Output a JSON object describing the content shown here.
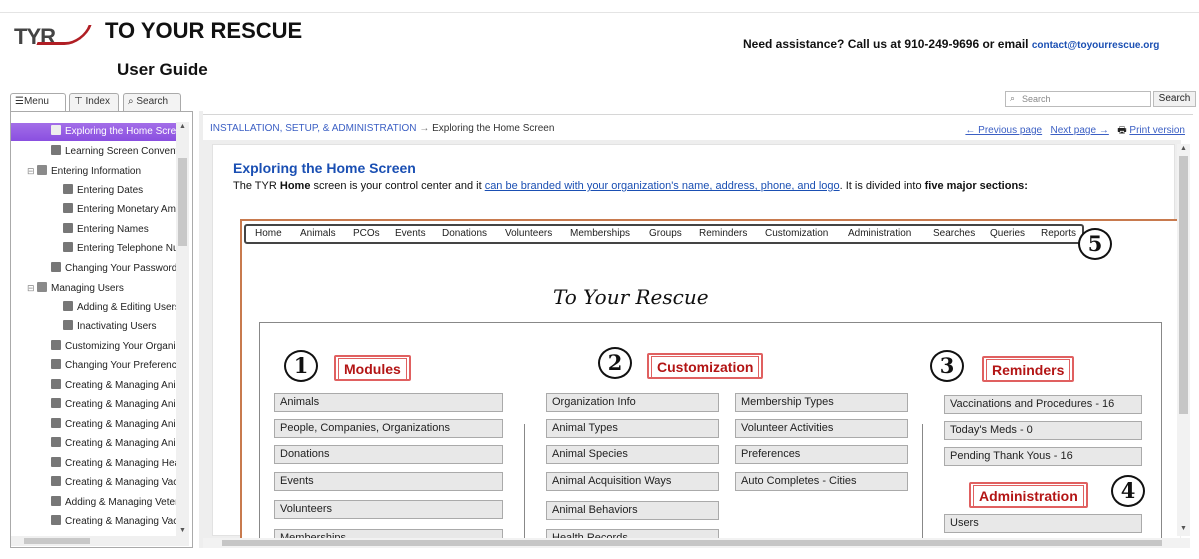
{
  "header": {
    "logo_text": "TYR",
    "title": "TO YOUR RESCUE",
    "subtitle": "User Guide",
    "assist_text": "Need assistance? Call us at 910-249-9696 or email ",
    "assist_email": "contact@toyourrescue.org"
  },
  "nav_tabs": [
    {
      "label": "Menu",
      "icon": "menu-icon"
    },
    {
      "label": "Index",
      "icon": "index-icon"
    },
    {
      "label": "Search",
      "icon": "search-icon"
    }
  ],
  "tree": [
    {
      "label": "Exploring the Home Screen",
      "depth": 1,
      "selected": true
    },
    {
      "label": "Learning Screen Conventions",
      "depth": 1
    },
    {
      "label": "Entering Information",
      "depth": 0,
      "folder": true
    },
    {
      "label": "Entering Dates",
      "depth": 2
    },
    {
      "label": "Entering Monetary Amounts",
      "depth": 2
    },
    {
      "label": "Entering Names",
      "depth": 2
    },
    {
      "label": "Entering Telephone Numbers",
      "depth": 2
    },
    {
      "label": "Changing Your Password",
      "depth": 1
    },
    {
      "label": "Managing Users",
      "depth": 0,
      "folder": true
    },
    {
      "label": "Adding & Editing Users",
      "depth": 2
    },
    {
      "label": "Inactivating Users",
      "depth": 2
    },
    {
      "label": "Customizing Your Organization",
      "depth": 1
    },
    {
      "label": "Changing Your Preferences",
      "depth": 1
    },
    {
      "label": "Creating & Managing Animals",
      "depth": 1
    },
    {
      "label": "Creating & Managing Animal Types",
      "depth": 1
    },
    {
      "label": "Creating & Managing Animal Species",
      "depth": 1
    },
    {
      "label": "Creating & Managing Animal Behaviors",
      "depth": 1
    },
    {
      "label": "Creating & Managing Health Records",
      "depth": 1
    },
    {
      "label": "Creating & Managing Vaccinations",
      "depth": 1
    },
    {
      "label": "Adding & Managing Veterinarians",
      "depth": 1
    },
    {
      "label": "Creating & Managing Vaccine Types",
      "depth": 1
    }
  ],
  "search": {
    "placeholder": "Search",
    "button": "Search"
  },
  "breadcrumb": {
    "parent": "INSTALLATION, SETUP, & ADMINISTRATION",
    "separator": "→",
    "current": "Exploring the Home Screen"
  },
  "pagenav": {
    "prev": "← Previous page",
    "next": "Next page →",
    "print": "Print version"
  },
  "article": {
    "title": "Exploring the Home Screen",
    "intro_1": "The TYR ",
    "intro_bold": "Home",
    "intro_2": " screen is your control center and it ",
    "intro_link": "can be branded with your organization's name, address, phone, and logo",
    "intro_3": ". It is divided into ",
    "intro_bold2": "five major sections:"
  },
  "shot": {
    "menu": [
      "Home",
      "Animals",
      "PCOs",
      "Events",
      "Donations",
      "Volunteers",
      "Memberships",
      "Groups",
      "Reminders",
      "Customization",
      "Administration",
      "Searches",
      "Queries",
      "Reports"
    ],
    "title": "To Your Rescue",
    "numbers": [
      "1",
      "2",
      "3",
      "4",
      "5"
    ],
    "modules_label": "Modules",
    "customization_label": "Customization",
    "reminders_label": "Reminders",
    "administration_label": "Administration",
    "modules": [
      "Animals",
      "People, Companies, Organizations",
      "Donations",
      "Events",
      "Volunteers",
      "Memberships"
    ],
    "custom_col1": [
      "Organization Info",
      "Animal Types",
      "Animal Species",
      "Animal Acquisition Ways",
      "Animal Behaviors",
      "Health Records"
    ],
    "custom_col2": [
      "Membership Types",
      "Volunteer Activities",
      "Preferences",
      "Auto Completes - Cities"
    ],
    "reminders": [
      "Vaccinations and Procedures - 16",
      "Today's Meds - 0",
      "Pending Thank Yous - 16"
    ],
    "admin": [
      "Users"
    ]
  }
}
